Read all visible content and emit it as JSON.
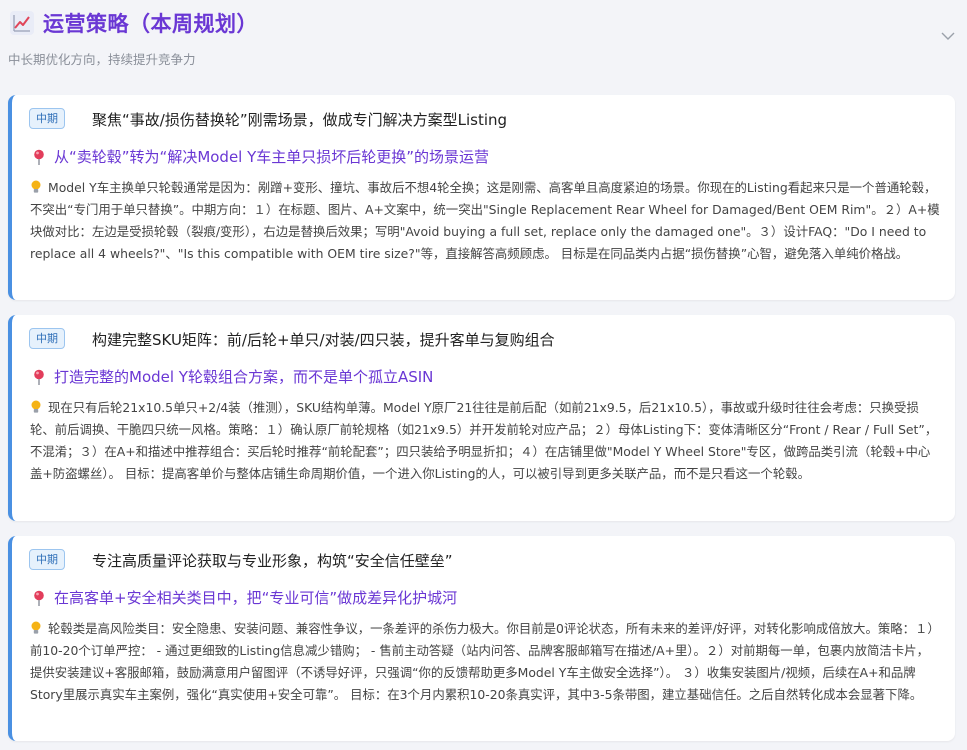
{
  "header": {
    "title": "运营策略（本周规划）",
    "subtitle": "中长期优化方向，持续提升竞争力",
    "icon": "chart-increasing-icon",
    "collapse_icon": "chevron-down-icon"
  },
  "colors": {
    "accent": "#6a37d4",
    "card_border": "#4a90e2",
    "badge_bg": "#e6f1fc",
    "badge_text": "#2f6fb8",
    "pin": "#e23d5b",
    "bulb": "#f5b316"
  },
  "cards": [
    {
      "badge": "中期",
      "title": "聚焦“事故/损伤替换轮”刚需场景，做成专门解决方案型Listing",
      "goal": "从“卖轮毂”转为“解决Model Y车主单只损坏后轮更换”的场景运营",
      "detail": "Model Y车主换单只轮毂通常是因为：剐蹭+变形、撞坑、事故后不想4轮全换；这是刚需、高客单且高度紧迫的场景。你现在的Listing看起来只是一个普通轮毂，不突出“专门用于单只替换”。中期方向：１）在标题、图片、A+文案中，统一突出\"Single Replacement Rear Wheel for Damaged/Bent OEM Rim\"。２）A+模块做对比：左边是受损轮毂（裂痕/变形），右边是替换后效果；写明\"Avoid buying a full set, replace only the damaged one\"。３）设计FAQ：\"Do I need to replace all 4 wheels?\"、\"Is this compatible with OEM tire size?\"等，直接解答高频顾虑。 目标是在同品类内占据“损伤替换”心智，避免落入单纯价格战。"
    },
    {
      "badge": "中期",
      "title": "构建完整SKU矩阵：前/后轮+单只/对装/四只装，提升客单与复购组合",
      "goal": "打造完整的Model Y轮毂组合方案，而不是单个孤立ASIN",
      "detail": "现在只有后轮21x10.5单只+2/4装（推测），SKU结构单薄。Model Y原厂21往往是前后配（如前21x9.5，后21x10.5），事故或升级时往往会考虑：只换受损轮、前后调换、干脆四只统一风格。策略：１）确认原厂前轮规格（如21x9.5）并开发前轮对应产品；２）母体Listing下：变体清晰区分“Front / Rear / Full Set”，不混淆；３）在A+和描述中推荐组合：买后轮时推荐“前轮配套”；四只装给予明显折扣；４）在店铺里做\"Model Y Wheel Store\"专区，做跨品类引流（轮毂+中心盖+防盗螺丝）。 目标：提高客单价与整体店铺生命周期价值，一个进入你Listing的人，可以被引导到更多关联产品，而不是只看这一个轮毂。"
    },
    {
      "badge": "中期",
      "title": "专注高质量评论获取与专业形象，构筑“安全信任壁垒”",
      "goal": "在高客单+安全相关类目中，把“专业可信”做成差异化护城河",
      "detail": "轮毂类是高风险类目：安全隐患、安装问题、兼容性争议，一条差评的杀伤力极大。你目前是0评论状态，所有未来的差评/好评，对转化影响成倍放大。策略：１）前10-20个订单严控： - 通过更细致的Listing信息减少错购； - 售前主动答疑（站内问答、品牌客服邮箱写在描述/A+里）。２）对前期每一单，包裹内放简洁卡片，提供安装建议+客服邮箱，鼓励满意用户留图评（不诱导好评，只强调“你的反馈帮助更多Model Y车主做安全选择”）。 ３）收集安装图片/视频，后续在A+和品牌Story里展示真实车主案例，强化“真实使用+安全可靠”。 目标：在3个月内累积10-20条真实评，其中3-5条带图，建立基础信任。之后自然转化成本会显著下降。"
    }
  ]
}
